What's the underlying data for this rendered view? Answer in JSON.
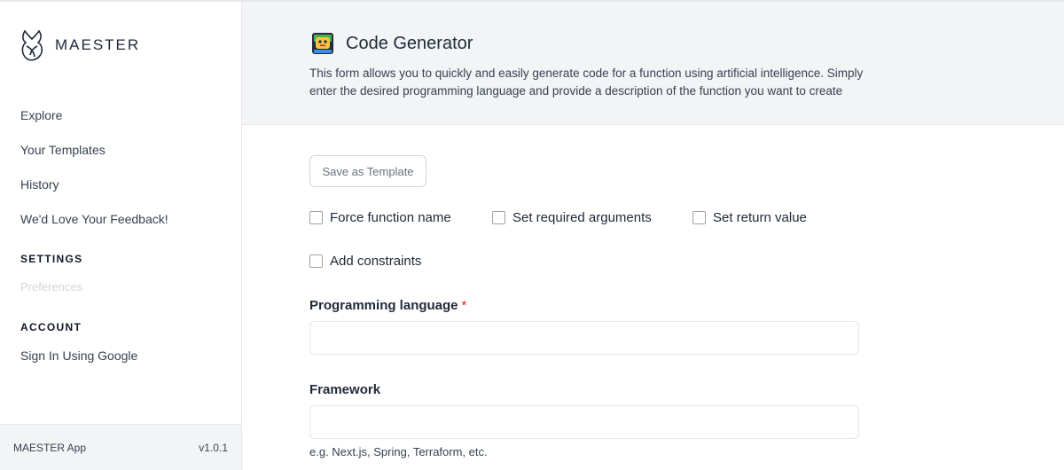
{
  "brand": {
    "name": "MAESTER"
  },
  "sidebar": {
    "nav": [
      {
        "label": "Explore"
      },
      {
        "label": "Your Templates"
      },
      {
        "label": "History"
      },
      {
        "label": "We'd Love Your Feedback!"
      }
    ],
    "settings_title": "SETTINGS",
    "preferences_label": "Preferences",
    "account_title": "ACCOUNT",
    "signin_label": "Sign In Using Google",
    "footer": {
      "app_name": "MAESTER App",
      "version": "v1.0.1"
    }
  },
  "header": {
    "icon": "robot-icon",
    "title": "Code Generator",
    "description": "This form allows you to quickly and easily generate code for a function using artificial intelligence. Simply enter the desired programming language and provide a description of the function you want to create"
  },
  "form": {
    "save_template_label": "Save as Template",
    "options": [
      {
        "label": "Force function name",
        "checked": false
      },
      {
        "label": "Set required arguments",
        "checked": false
      },
      {
        "label": "Set return value",
        "checked": false
      },
      {
        "label": "Add constraints",
        "checked": false
      }
    ],
    "language": {
      "label": "Programming language",
      "required_mark": "*",
      "value": ""
    },
    "framework": {
      "label": "Framework",
      "value": "",
      "hint": "e.g. Next.js, Spring, Terraform, etc."
    }
  },
  "colors": {
    "required": "#dc2626",
    "header_bg": "#f3f4f6",
    "border": "#e5e7eb"
  }
}
